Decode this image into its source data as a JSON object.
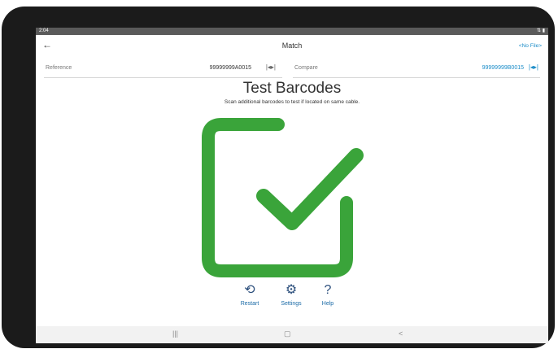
{
  "status": {
    "time": "2:04",
    "right_icons": "⇅ ▮"
  },
  "appbar": {
    "title": "Match",
    "file_label": "<No File>"
  },
  "fields": {
    "reference": {
      "label": "Reference",
      "value": "99999999A0015"
    },
    "compare": {
      "label": "Compare",
      "value": "99999999B0015"
    }
  },
  "main": {
    "heading": "Test Barcodes",
    "subtext": "Scan additional barcodes to test if located on same cable."
  },
  "actions": [
    {
      "label": "Restart",
      "icon": "restart-icon"
    },
    {
      "label": "Settings",
      "icon": "gear-icon"
    },
    {
      "label": "Help",
      "icon": "help-icon"
    }
  ],
  "navbar": {
    "recent": "|||",
    "home": "▢",
    "back": "<"
  },
  "colors": {
    "accent": "#1a8cc8",
    "check": "#3aa43a"
  }
}
